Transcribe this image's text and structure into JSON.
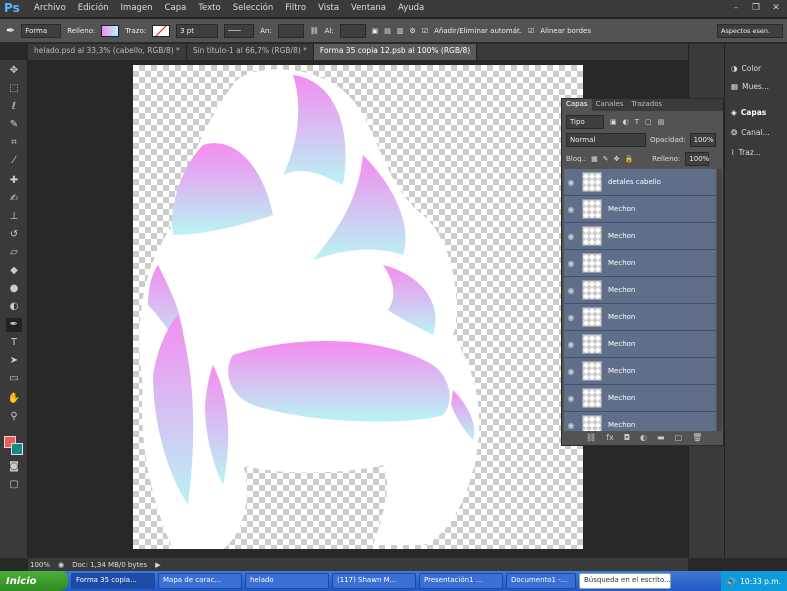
{
  "app": {
    "logo": "Ps",
    "menu": [
      "Archivo",
      "Edición",
      "Imagen",
      "Capa",
      "Texto",
      "Selección",
      "Filtro",
      "Vista",
      "Ventana",
      "Ayuda"
    ]
  },
  "options": {
    "mode": "Forma",
    "fill_label": "Relleno:",
    "stroke_label": "Trazo:",
    "stroke_size": "3 pt",
    "w_label": "An:",
    "h_label": "Al:",
    "auto_add": "Añadir/Eliminar automát.",
    "align_edges": "Alinear bordes",
    "workspace": "Aspectos esen."
  },
  "tabs": [
    {
      "label": "helado.psd al 33,3% (cabello, RGB/8) *"
    },
    {
      "label": "Sin título-1 al 66,7% (RGB/8) *"
    },
    {
      "label": "Forma 35 copia 12.psb al 100% (RGB/8)"
    }
  ],
  "status": {
    "zoom": "100%",
    "doc": "Doc: 1,34 MB/0 bytes"
  },
  "rightpanel": {
    "items": [
      "Color",
      "Mues...",
      "Capas",
      "Canal...",
      "Traz..."
    ]
  },
  "layers": {
    "tabs": [
      "Capas",
      "Canales",
      "Trazados"
    ],
    "kind": "Tipo",
    "blend": "Normal",
    "opacity_label": "Opacidad:",
    "opacity": "100%",
    "lock_label": "Bloq.:",
    "fill_label": "Relleno:",
    "fill": "100%",
    "rows": [
      {
        "name": "detales cabello"
      },
      {
        "name": "Mechon"
      },
      {
        "name": "Mechon"
      },
      {
        "name": "Mechon"
      },
      {
        "name": "Mechon"
      },
      {
        "name": "Mechon"
      },
      {
        "name": "Mechon"
      },
      {
        "name": "Mechon"
      },
      {
        "name": "Mechon"
      },
      {
        "name": "Mechon"
      }
    ]
  },
  "taskbar": {
    "start": "Inicio",
    "tasks": [
      "Forma 35 copia...",
      "Mapa de carac...",
      "helado",
      "(117) Shawn M...",
      "Presentación1 ...",
      "Documento1 -..."
    ],
    "search": "Búsqueda en el escrito...",
    "time": "10:33 p.m."
  },
  "colors": {
    "pink": "#f48cf0",
    "cyan": "#b8f4f4",
    "fg": "#e8604c",
    "bg": "#1a8a7c"
  }
}
